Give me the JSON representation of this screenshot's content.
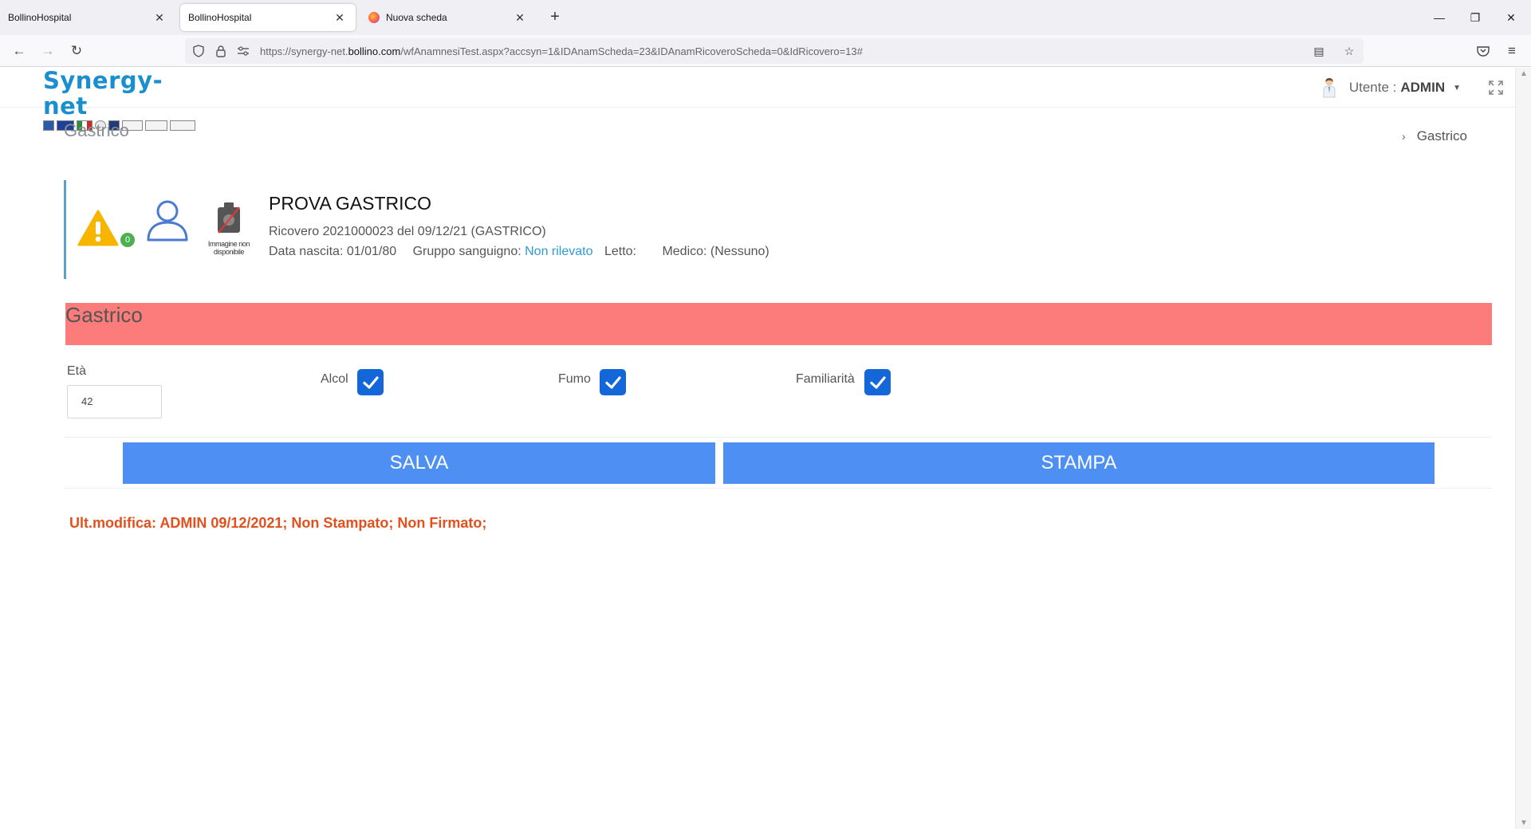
{
  "browser": {
    "tabs": [
      {
        "title": "BollinoHospital",
        "active": false
      },
      {
        "title": "BollinoHospital",
        "active": true
      },
      {
        "title": "Nuova scheda",
        "active": false
      }
    ],
    "url_prefix": "https://synergy-net.",
    "url_domain": "bollino.com",
    "url_path": "/wfAnamnesiTest.aspx?accsyn=1&IDAnamScheda=23&IDAnamRicoveroScheda=0&IdRicovero=13#"
  },
  "header": {
    "logo_text": "Synergy-net",
    "user_label": "Utente :",
    "user_name": "ADMIN"
  },
  "page": {
    "title": "Gastrico",
    "breadcrumb": "Gastrico"
  },
  "patient": {
    "name": "PROVA GASTRICO",
    "alert_count": "0",
    "no_image_label": "Immagine non disponibile",
    "ricovero": "Ricovero 2021000023  del 09/12/21 (GASTRICO)",
    "birth_label": "Data nascita: 01/01/80",
    "blood_label": "Gruppo sanguigno:",
    "blood_value": "Non rilevato",
    "bed_label": "Letto:",
    "doctor_label": "Medico: (Nessuno)"
  },
  "form": {
    "section_title": "Gastrico",
    "eta_label": "Età",
    "eta_value": "42",
    "alcol_label": "Alcol",
    "alcol_checked": true,
    "fumo_label": "Fumo",
    "fumo_checked": true,
    "familiarita_label": "Familiarità",
    "familiarita_checked": true,
    "save_label": "SALVA",
    "print_label": "STAMPA"
  },
  "status": {
    "text": "Ult.modifica: ADMIN 09/12/2021; Non Stampato; Non Firmato;"
  },
  "colors": {
    "section_bar": "#fc7c7b",
    "button": "#4d8ff3",
    "checkbox": "#1467d8",
    "status_text": "#e2501d",
    "link": "#2e9bd6"
  }
}
